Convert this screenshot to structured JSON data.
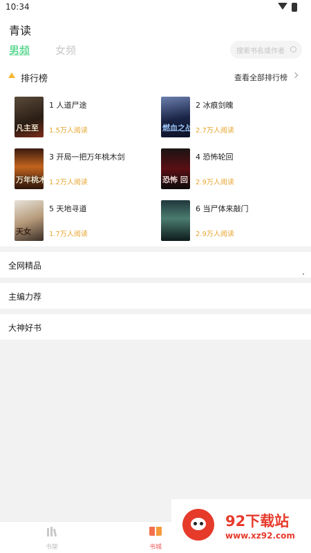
{
  "status_bar": {
    "time": "10:34",
    "icons": [
      "wifi-icon",
      "battery-icon"
    ]
  },
  "app": {
    "title": "青读"
  },
  "tabs": [
    {
      "label": "男频",
      "active": true
    },
    {
      "label": "女频",
      "active": false
    }
  ],
  "search": {
    "placeholder": "搜索书名或作者",
    "icon": "search-icon"
  },
  "ranking": {
    "title": "排行榜",
    "view_all": "查看全部排行榜",
    "books": [
      {
        "rank_title": "1 人道尸途",
        "reads": "1.5万人阅读",
        "cover_text": "凡主至"
      },
      {
        "rank_title": "2 冰痕剑魄",
        "reads": "2.7万人阅读",
        "cover_text": "燃血之战帝"
      },
      {
        "rank_title": "3 开局一把万年桃木剑",
        "reads": "1.2万人阅读",
        "cover_text": "万年桃木剑"
      },
      {
        "rank_title": "4 恐怖轮回",
        "reads": "2.9万人阅读",
        "cover_text": "恐怖 回"
      },
      {
        "rank_title": "5 天地寻道",
        "reads": "1.7万人阅读",
        "cover_text": "天女"
      },
      {
        "rank_title": "6 当尸体来敲门",
        "reads": "2.9万人阅读",
        "cover_text": ""
      }
    ]
  },
  "sections": [
    {
      "title": "全网精品"
    },
    {
      "title": "主编力荐"
    },
    {
      "title": "大神好书"
    }
  ],
  "bottom_nav": [
    {
      "label": "书架",
      "icon": "bookshelf-icon",
      "active": false
    },
    {
      "label": "书城",
      "icon": "book-store-icon",
      "active": true
    }
  ],
  "watermark": {
    "title": "92下载站",
    "url": "www.xz92.com"
  },
  "colors": {
    "accent": "#2ecc71",
    "reads": "#e7a52f",
    "nav_active": "#f05a5a"
  }
}
